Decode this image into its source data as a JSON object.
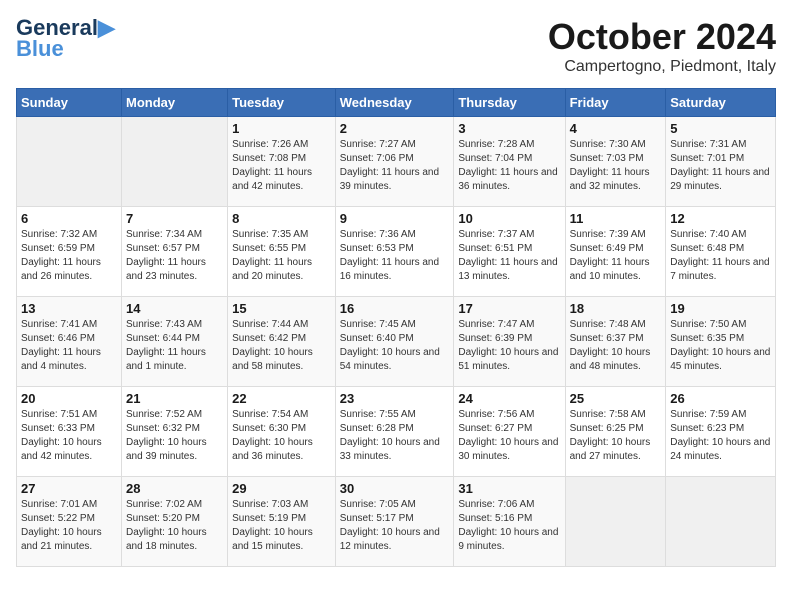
{
  "header": {
    "logo_general": "General",
    "logo_blue": "Blue",
    "month_title": "October 2024",
    "location": "Campertogno, Piedmont, Italy"
  },
  "days_of_week": [
    "Sunday",
    "Monday",
    "Tuesday",
    "Wednesday",
    "Thursday",
    "Friday",
    "Saturday"
  ],
  "weeks": [
    [
      {
        "day": "",
        "info": ""
      },
      {
        "day": "",
        "info": ""
      },
      {
        "day": "1",
        "info": "Sunrise: 7:26 AM\nSunset: 7:08 PM\nDaylight: 11 hours and 42 minutes."
      },
      {
        "day": "2",
        "info": "Sunrise: 7:27 AM\nSunset: 7:06 PM\nDaylight: 11 hours and 39 minutes."
      },
      {
        "day": "3",
        "info": "Sunrise: 7:28 AM\nSunset: 7:04 PM\nDaylight: 11 hours and 36 minutes."
      },
      {
        "day": "4",
        "info": "Sunrise: 7:30 AM\nSunset: 7:03 PM\nDaylight: 11 hours and 32 minutes."
      },
      {
        "day": "5",
        "info": "Sunrise: 7:31 AM\nSunset: 7:01 PM\nDaylight: 11 hours and 29 minutes."
      }
    ],
    [
      {
        "day": "6",
        "info": "Sunrise: 7:32 AM\nSunset: 6:59 PM\nDaylight: 11 hours and 26 minutes."
      },
      {
        "day": "7",
        "info": "Sunrise: 7:34 AM\nSunset: 6:57 PM\nDaylight: 11 hours and 23 minutes."
      },
      {
        "day": "8",
        "info": "Sunrise: 7:35 AM\nSunset: 6:55 PM\nDaylight: 11 hours and 20 minutes."
      },
      {
        "day": "9",
        "info": "Sunrise: 7:36 AM\nSunset: 6:53 PM\nDaylight: 11 hours and 16 minutes."
      },
      {
        "day": "10",
        "info": "Sunrise: 7:37 AM\nSunset: 6:51 PM\nDaylight: 11 hours and 13 minutes."
      },
      {
        "day": "11",
        "info": "Sunrise: 7:39 AM\nSunset: 6:49 PM\nDaylight: 11 hours and 10 minutes."
      },
      {
        "day": "12",
        "info": "Sunrise: 7:40 AM\nSunset: 6:48 PM\nDaylight: 11 hours and 7 minutes."
      }
    ],
    [
      {
        "day": "13",
        "info": "Sunrise: 7:41 AM\nSunset: 6:46 PM\nDaylight: 11 hours and 4 minutes."
      },
      {
        "day": "14",
        "info": "Sunrise: 7:43 AM\nSunset: 6:44 PM\nDaylight: 11 hours and 1 minute."
      },
      {
        "day": "15",
        "info": "Sunrise: 7:44 AM\nSunset: 6:42 PM\nDaylight: 10 hours and 58 minutes."
      },
      {
        "day": "16",
        "info": "Sunrise: 7:45 AM\nSunset: 6:40 PM\nDaylight: 10 hours and 54 minutes."
      },
      {
        "day": "17",
        "info": "Sunrise: 7:47 AM\nSunset: 6:39 PM\nDaylight: 10 hours and 51 minutes."
      },
      {
        "day": "18",
        "info": "Sunrise: 7:48 AM\nSunset: 6:37 PM\nDaylight: 10 hours and 48 minutes."
      },
      {
        "day": "19",
        "info": "Sunrise: 7:50 AM\nSunset: 6:35 PM\nDaylight: 10 hours and 45 minutes."
      }
    ],
    [
      {
        "day": "20",
        "info": "Sunrise: 7:51 AM\nSunset: 6:33 PM\nDaylight: 10 hours and 42 minutes."
      },
      {
        "day": "21",
        "info": "Sunrise: 7:52 AM\nSunset: 6:32 PM\nDaylight: 10 hours and 39 minutes."
      },
      {
        "day": "22",
        "info": "Sunrise: 7:54 AM\nSunset: 6:30 PM\nDaylight: 10 hours and 36 minutes."
      },
      {
        "day": "23",
        "info": "Sunrise: 7:55 AM\nSunset: 6:28 PM\nDaylight: 10 hours and 33 minutes."
      },
      {
        "day": "24",
        "info": "Sunrise: 7:56 AM\nSunset: 6:27 PM\nDaylight: 10 hours and 30 minutes."
      },
      {
        "day": "25",
        "info": "Sunrise: 7:58 AM\nSunset: 6:25 PM\nDaylight: 10 hours and 27 minutes."
      },
      {
        "day": "26",
        "info": "Sunrise: 7:59 AM\nSunset: 6:23 PM\nDaylight: 10 hours and 24 minutes."
      }
    ],
    [
      {
        "day": "27",
        "info": "Sunrise: 7:01 AM\nSunset: 5:22 PM\nDaylight: 10 hours and 21 minutes."
      },
      {
        "day": "28",
        "info": "Sunrise: 7:02 AM\nSunset: 5:20 PM\nDaylight: 10 hours and 18 minutes."
      },
      {
        "day": "29",
        "info": "Sunrise: 7:03 AM\nSunset: 5:19 PM\nDaylight: 10 hours and 15 minutes."
      },
      {
        "day": "30",
        "info": "Sunrise: 7:05 AM\nSunset: 5:17 PM\nDaylight: 10 hours and 12 minutes."
      },
      {
        "day": "31",
        "info": "Sunrise: 7:06 AM\nSunset: 5:16 PM\nDaylight: 10 hours and 9 minutes."
      },
      {
        "day": "",
        "info": ""
      },
      {
        "day": "",
        "info": ""
      }
    ]
  ]
}
